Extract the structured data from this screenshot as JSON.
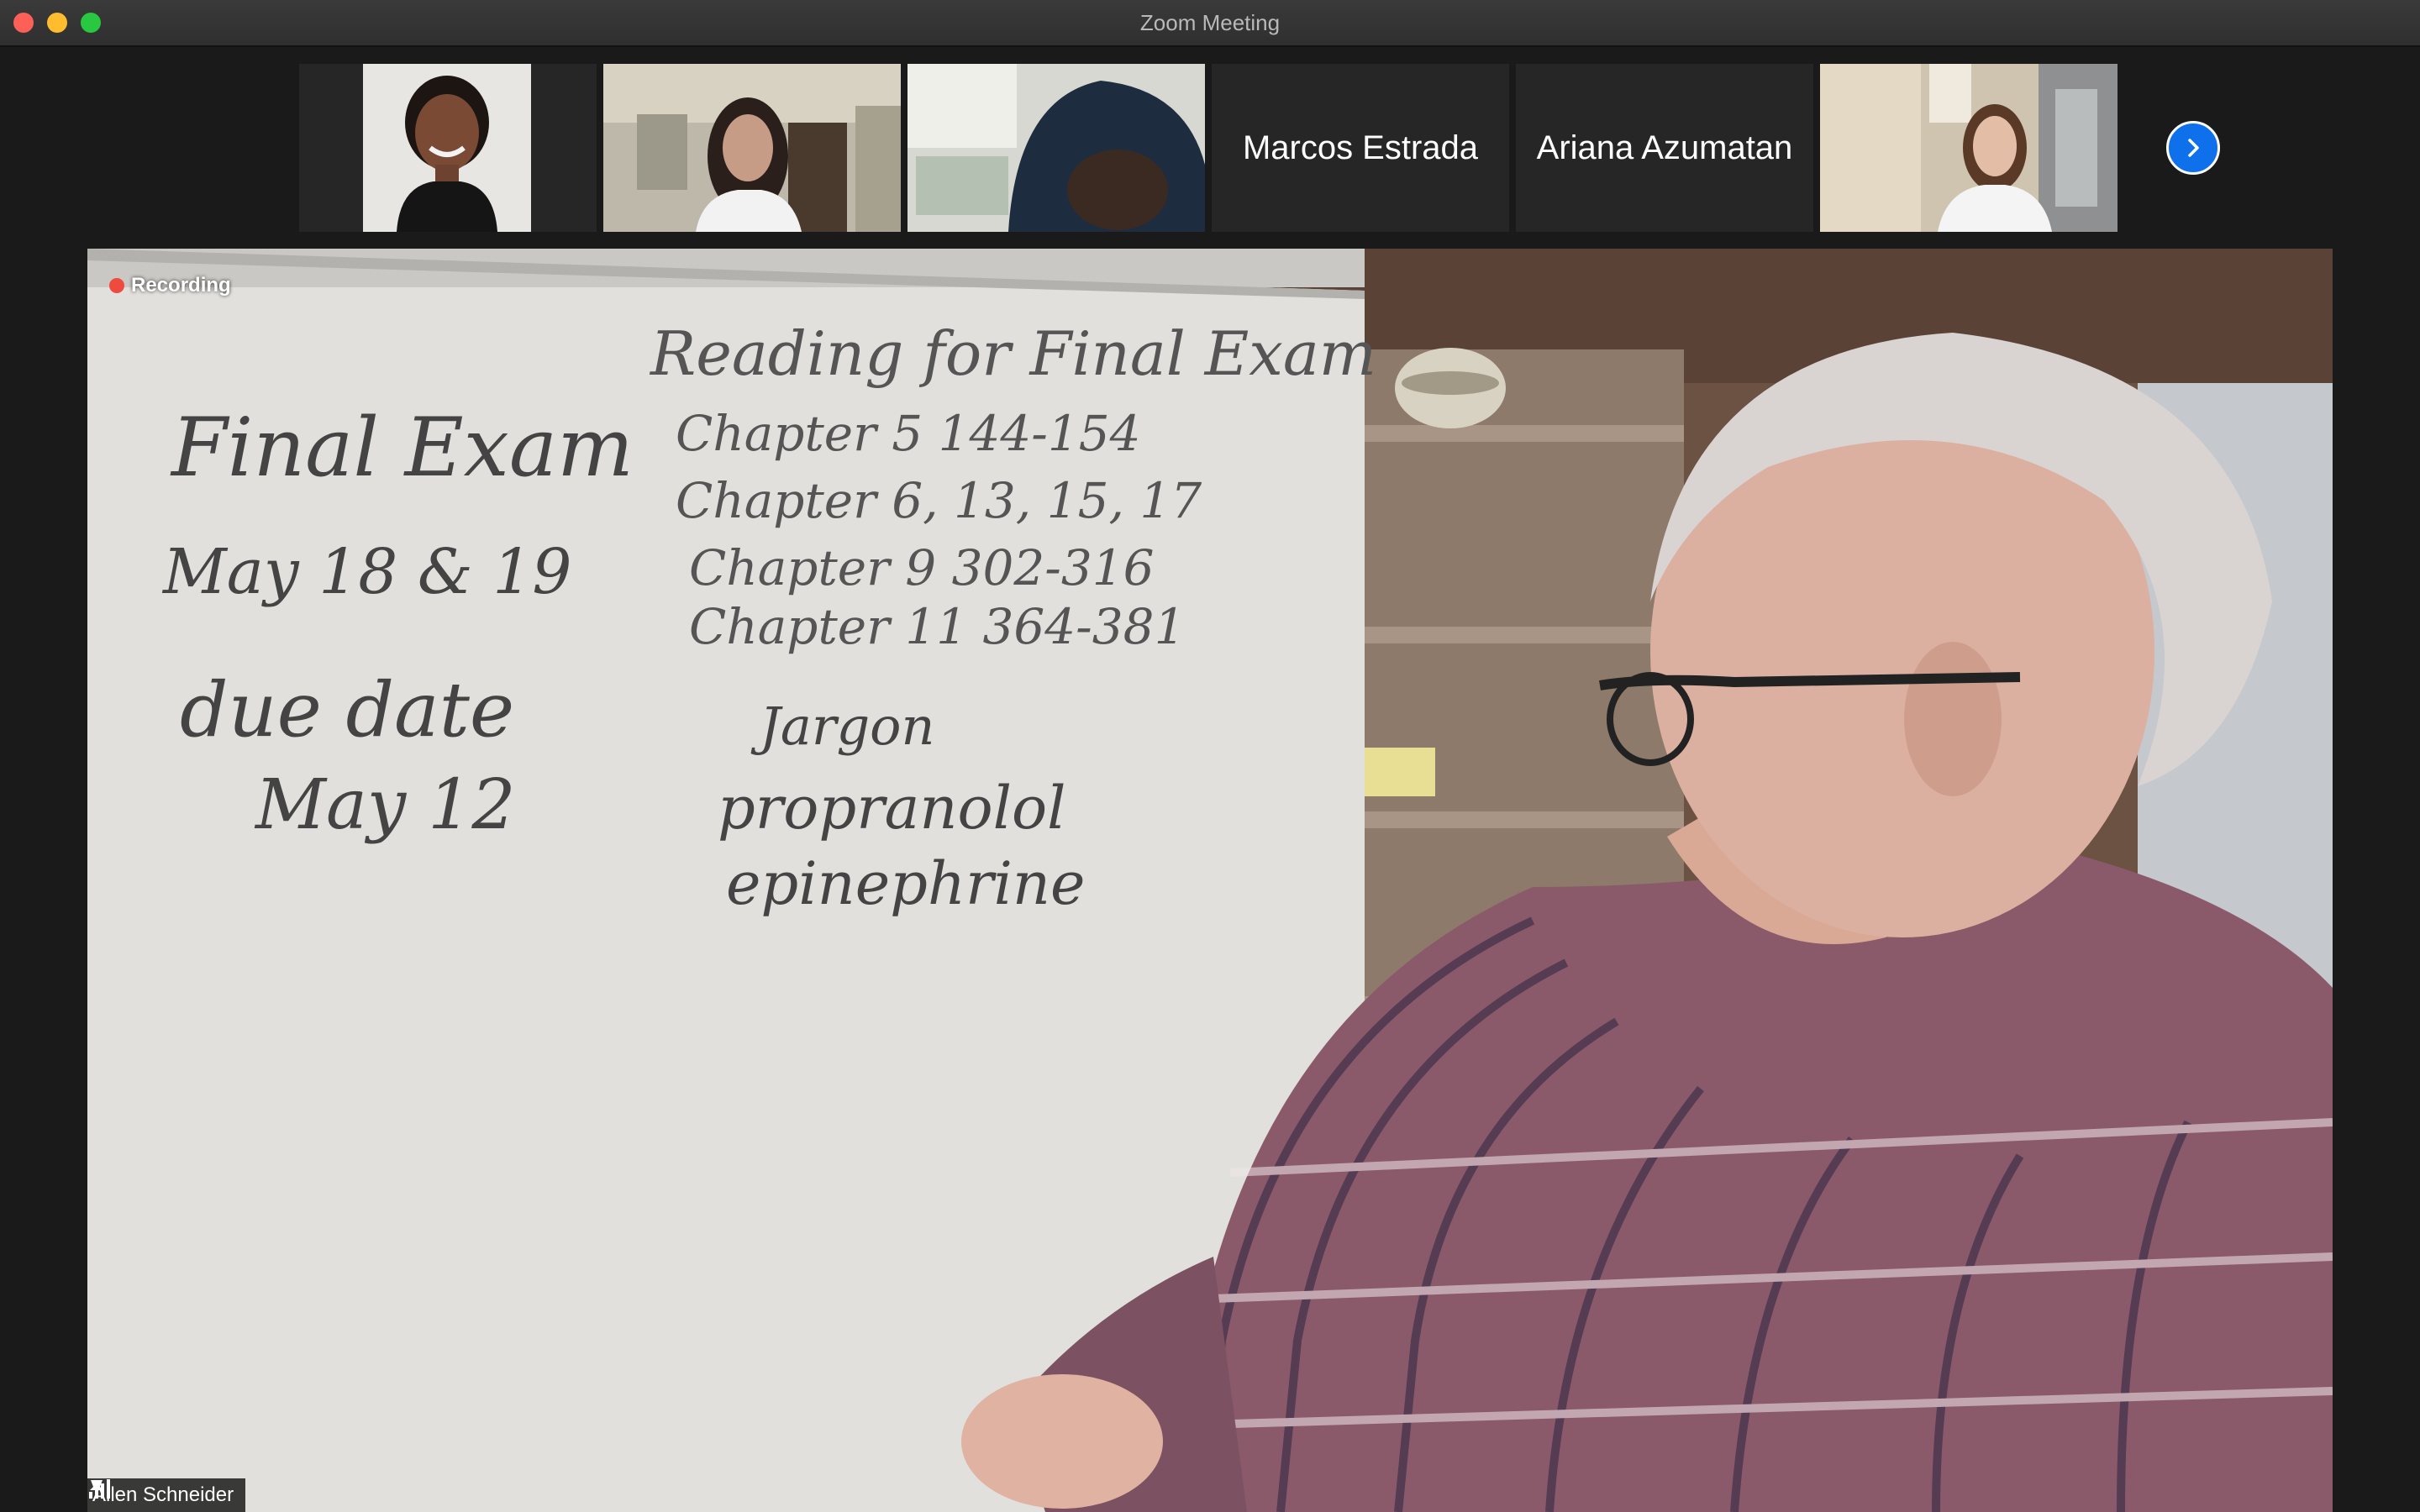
{
  "window": {
    "title": "Zoom Meeting"
  },
  "gallery": {
    "participants": [
      {
        "type": "video",
        "description": "participant-video-1"
      },
      {
        "type": "video",
        "description": "participant-video-2"
      },
      {
        "type": "video",
        "description": "participant-video-3"
      },
      {
        "type": "name",
        "name": "Marcos Estrada"
      },
      {
        "type": "name",
        "name": "Ariana Azumatan"
      },
      {
        "type": "video",
        "description": "participant-video-6"
      }
    ],
    "next_icon": "chevron-right-icon"
  },
  "main": {
    "recording_label": "Recording",
    "speaker_name": "Allen Schneider",
    "whiteboard": {
      "left_lines": [
        "Final Exam",
        "May 18 & 19",
        "due date",
        "May 12"
      ],
      "right_title": "Reading for Final Exam",
      "right_lines": [
        "Chapter 5 144-154",
        "Chapter 6, 13, 15, 17",
        "Chapter 9 302-316",
        "Chapter 11 364-381",
        "Jargon",
        "propranolol",
        "epinephrine"
      ]
    }
  },
  "colors": {
    "accent_blue": "#0e71eb",
    "recording_red": "#ee4a3d"
  }
}
